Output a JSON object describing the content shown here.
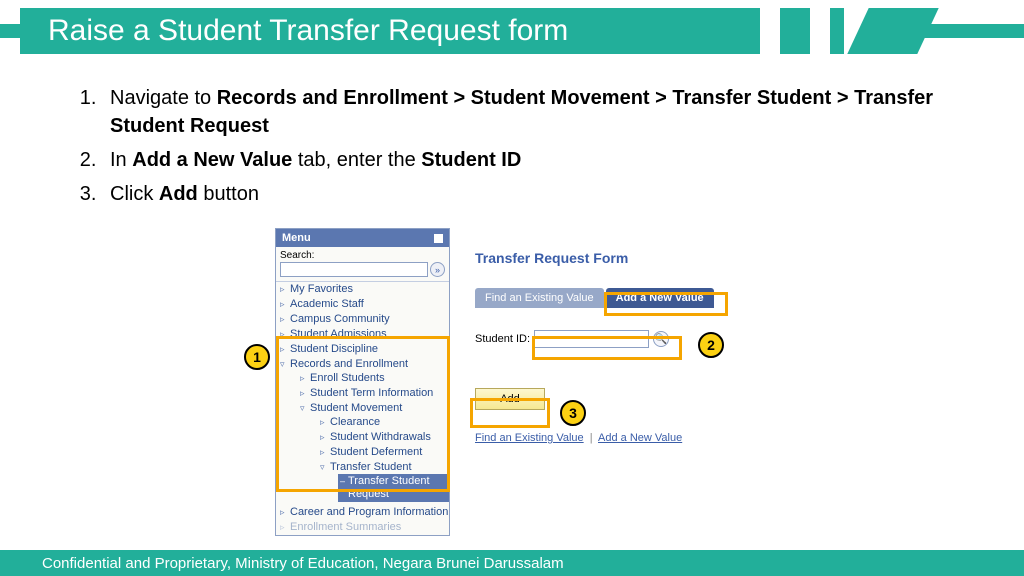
{
  "title": "Raise a Student Transfer Request form",
  "steps": {
    "s1a": "Navigate to ",
    "s1b": "Records and Enrollment > Student Movement > Transfer Student > Transfer Student Request",
    "s2a": "In ",
    "s2b": "Add a New Value",
    "s2c": " tab, enter the ",
    "s2d": "Student ID",
    "s3a": "Click ",
    "s3b": "Add",
    "s3c": " button"
  },
  "menu": {
    "title": "Menu",
    "search_label": "Search:",
    "items": {
      "fav": "My Favorites",
      "staff": "Academic Staff",
      "campus": "Campus Community",
      "adm": "Student Admissions",
      "disc": "Student Discipline",
      "rec": "Records and Enrollment",
      "enroll": "Enroll Students",
      "term": "Student Term Information",
      "move": "Student Movement",
      "clr": "Clearance",
      "wd": "Student Withdrawals",
      "def": "Student Deferment",
      "ts": "Transfer Student",
      "tsr": "Transfer Student Request",
      "cpi": "Career and Program Information",
      "other": "Enrollment Summaries"
    }
  },
  "form": {
    "title": "Transfer Request Form",
    "tab_find": "Find an Existing Value",
    "tab_add": "Add a New Value",
    "field_label": "Student ID:",
    "add_btn": "Add",
    "link_find": "Find an Existing Value",
    "link_add": "Add a New Value"
  },
  "callouts": {
    "c1": "1",
    "c2": "2",
    "c3": "3"
  },
  "footer": "Confidential and Proprietary, Ministry of Education, Negara Brunei Darussalam"
}
